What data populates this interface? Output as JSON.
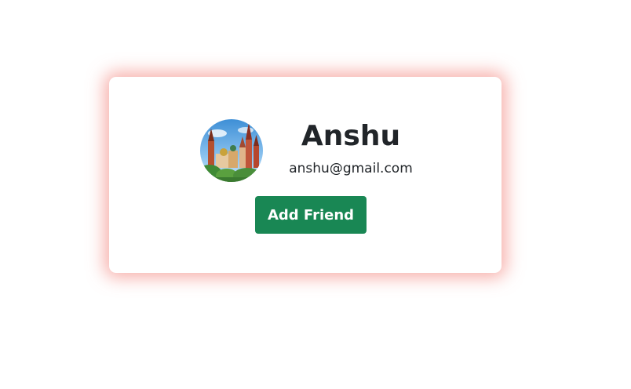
{
  "profile": {
    "name": "Anshu",
    "email": "anshu@gmail.com",
    "avatar_icon": "city-landmark-photo"
  },
  "actions": {
    "add_friend_label": "Add Friend"
  },
  "colors": {
    "button_bg": "#198754",
    "button_text": "#ffffff",
    "card_glow": "#f06e64",
    "text": "#212529"
  }
}
